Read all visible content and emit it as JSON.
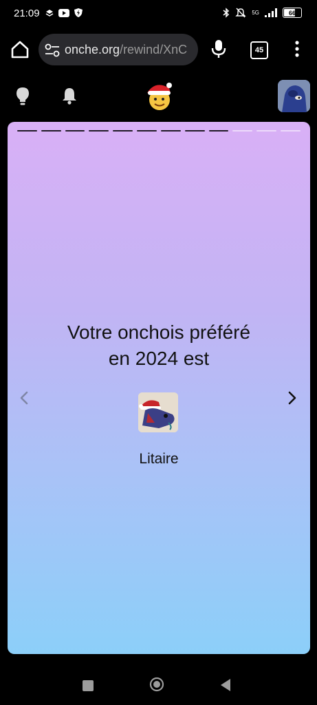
{
  "status_bar": {
    "time": "21:09",
    "left_icons": [
      "layers-icon",
      "youtube-icon",
      "shield-bolt-icon"
    ],
    "right_icons": [
      "bluetooth-icon",
      "muted-bell-icon",
      "signal-5g-icon"
    ],
    "network": "5G",
    "battery": "66"
  },
  "browser": {
    "url_domain": "onche.org",
    "url_path": "/rewind/XnC",
    "tab_count": "45"
  },
  "site_header": {
    "icons": [
      "lightbulb-icon",
      "bell-icon",
      "santa-logo-icon",
      "avatar"
    ]
  },
  "story": {
    "progress_total": 12,
    "progress_done": 9,
    "headline_line1": "Votre onchois préféré",
    "headline_line2": "en 2024 est",
    "favorite_name": "Litaire",
    "gradient_top": "#d9b0f6",
    "gradient_bottom": "#8ccff9"
  }
}
